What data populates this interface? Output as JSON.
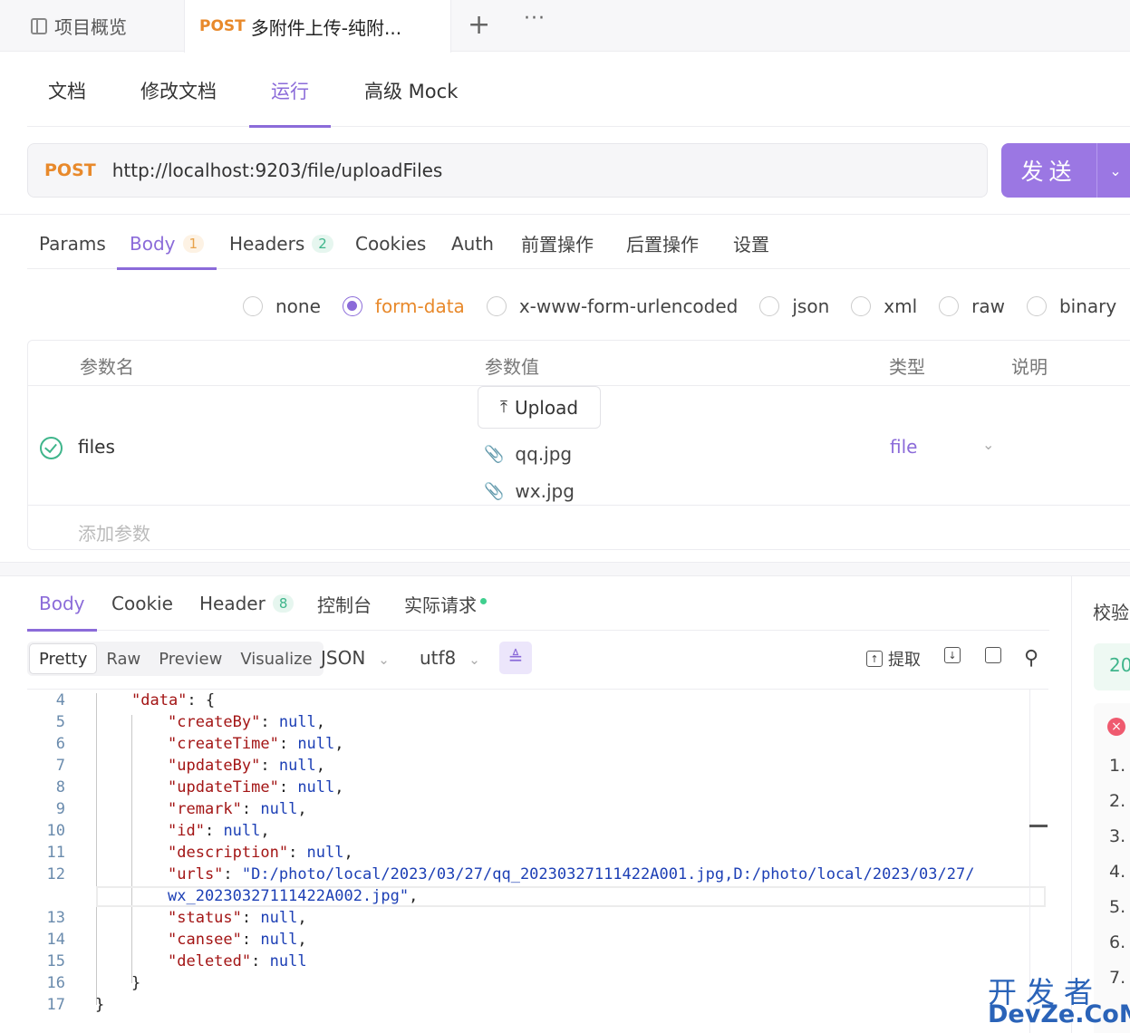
{
  "window_tabs": {
    "overview": "项目概览",
    "active_method": "POST",
    "active_title": "多附件上传-纯附...",
    "add_icon": "+",
    "more_icon": "···"
  },
  "doc_tabs": [
    "文档",
    "修改文档",
    "运行",
    "高级 Mock"
  ],
  "request": {
    "method": "POST",
    "url": "http://localhost:9203/file/uploadFiles",
    "send_label": "发送"
  },
  "request_tabs": [
    {
      "label": "Params"
    },
    {
      "label": "Body",
      "badge": "1"
    },
    {
      "label": "Headers",
      "badge": "2"
    },
    {
      "label": "Cookies"
    },
    {
      "label": "Auth"
    },
    {
      "label": "前置操作"
    },
    {
      "label": "后置操作"
    },
    {
      "label": "设置"
    }
  ],
  "body_types": [
    "none",
    "form-data",
    "x-www-form-urlencoded",
    "json",
    "xml",
    "raw",
    "binary"
  ],
  "body_type_selected": "form-data",
  "params_table": {
    "headers": [
      "参数名",
      "参数值",
      "类型",
      "说明"
    ],
    "row": {
      "name": "files",
      "upload_label": "Upload",
      "files": [
        "qq.jpg",
        "wx.jpg"
      ],
      "type": "file"
    },
    "add_placeholder": "添加参数"
  },
  "response_tabs": [
    {
      "label": "Body"
    },
    {
      "label": "Cookie"
    },
    {
      "label": "Header",
      "badge": "8"
    },
    {
      "label": "控制台"
    },
    {
      "label": "实际请求"
    }
  ],
  "view_modes": [
    "Pretty",
    "Raw",
    "Preview",
    "Visualize"
  ],
  "format": "JSON",
  "encoding": "utf8",
  "tools": {
    "extract": "提取"
  },
  "code_lines": [
    {
      "no": "4",
      "text": "\"data\": {"
    },
    {
      "no": "5",
      "text": "\"createBy\": null,"
    },
    {
      "no": "6",
      "text": "\"createTime\": null,"
    },
    {
      "no": "7",
      "text": "\"updateBy\": null,"
    },
    {
      "no": "8",
      "text": "\"updateTime\": null,"
    },
    {
      "no": "9",
      "text": "\"remark\": null,"
    },
    {
      "no": "10",
      "text": "\"id\": null,"
    },
    {
      "no": "11",
      "text": "\"description\": null,"
    },
    {
      "no": "12",
      "text": "\"urls\": \"D:/photo/local/2023/03/27/qq_20230327111422A001.jpg,D:/photo/local/2023/03/27/"
    },
    {
      "no": "",
      "text": "wx_20230327111422A002.jpg\","
    },
    {
      "no": "13",
      "text": "\"status\": null,"
    },
    {
      "no": "14",
      "text": "\"cansee\": null,"
    },
    {
      "no": "15",
      "text": "\"deleted\": null"
    },
    {
      "no": "16",
      "text": "}"
    },
    {
      "no": "17",
      "text": "}"
    }
  ],
  "right_panel": {
    "title": "校验",
    "status_code_partial": "20",
    "list_numbers": [
      "1.",
      "2.",
      "3.",
      "4.",
      "5.",
      "6.",
      "7."
    ]
  },
  "watermark": {
    "line1": "开发者",
    "line2": "DevZe.CoM"
  },
  "colors": {
    "accent": "#8b6bd9",
    "post": "#e8892b",
    "success": "#3fb58b",
    "send_bg": "#9b77e3"
  }
}
